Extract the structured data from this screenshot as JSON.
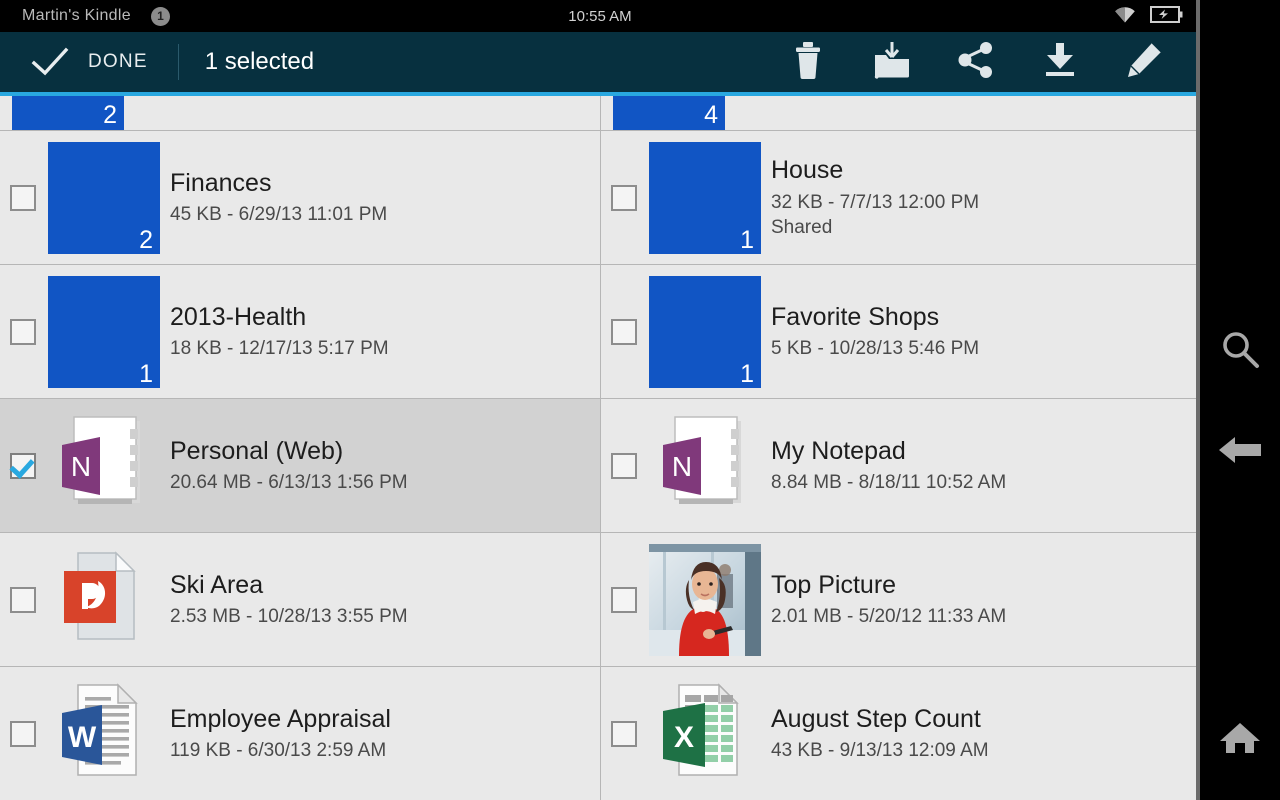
{
  "statusbar": {
    "device_title": "Martin's Kindle",
    "notification_badge": "1",
    "clock": "10:55 AM",
    "wifi_icon": "wifi-icon",
    "battery_icon": "battery-charging-icon"
  },
  "actionbar": {
    "done_label": "DONE",
    "selection_count": "1 selected",
    "check_icon": "checkmark-icon",
    "accent_color": "#29a8e0",
    "background_color": "#07303f",
    "actions": [
      {
        "name": "delete-button",
        "icon": "trash-icon"
      },
      {
        "name": "move-button",
        "icon": "move-to-folder-icon"
      },
      {
        "name": "share-button",
        "icon": "share-icon"
      },
      {
        "name": "download-button",
        "icon": "download-icon"
      },
      {
        "name": "rename-button",
        "icon": "pencil-icon"
      }
    ]
  },
  "navrail": {
    "search_icon": "search-icon",
    "back_icon": "back-arrow-icon",
    "home_icon": "home-icon"
  },
  "list": {
    "folder_color": "#1155c4",
    "partial_rows": [
      {
        "count": "2"
      },
      {
        "count": "4"
      }
    ],
    "items": [
      {
        "title": "Finances",
        "sub": "45 KB - 6/29/13 11:01 PM",
        "sub2": "",
        "icon": "folder-icon",
        "count": "2",
        "selected": false
      },
      {
        "title": "House",
        "sub": "32 KB - 7/7/13 12:00 PM",
        "sub2": "Shared",
        "icon": "folder-icon",
        "count": "1",
        "selected": false
      },
      {
        "title": "2013-Health",
        "sub": "18 KB - 12/17/13 5:17 PM",
        "sub2": "",
        "icon": "folder-icon",
        "count": "1",
        "selected": false
      },
      {
        "title": "Favorite Shops",
        "sub": "5 KB - 10/28/13 5:46 PM",
        "sub2": "",
        "icon": "folder-icon",
        "count": "1",
        "selected": false
      },
      {
        "title": "Personal (Web)",
        "sub": "20.64 MB - 6/13/13 1:56 PM",
        "sub2": "",
        "icon": "onenote-icon",
        "count": "",
        "selected": true
      },
      {
        "title": "My Notepad",
        "sub": "8.84 MB - 8/18/11 10:52 AM",
        "sub2": "",
        "icon": "onenote-icon",
        "count": "",
        "selected": false
      },
      {
        "title": "Ski Area",
        "sub": "2.53 MB - 10/28/13 3:55 PM",
        "sub2": "",
        "icon": "powerpoint-icon",
        "count": "",
        "selected": false
      },
      {
        "title": "Top Picture",
        "sub": "2.01 MB - 5/20/12 11:33 AM",
        "sub2": "",
        "icon": "photo-thumbnail",
        "count": "",
        "selected": false
      },
      {
        "title": "Employee Appraisal",
        "sub": "119 KB - 6/30/13 2:59 AM",
        "sub2": "",
        "icon": "word-icon",
        "count": "",
        "selected": false
      },
      {
        "title": "August Step Count",
        "sub": "43 KB - 9/13/13 12:09 AM",
        "sub2": "",
        "icon": "excel-icon",
        "count": "",
        "selected": false
      }
    ]
  }
}
